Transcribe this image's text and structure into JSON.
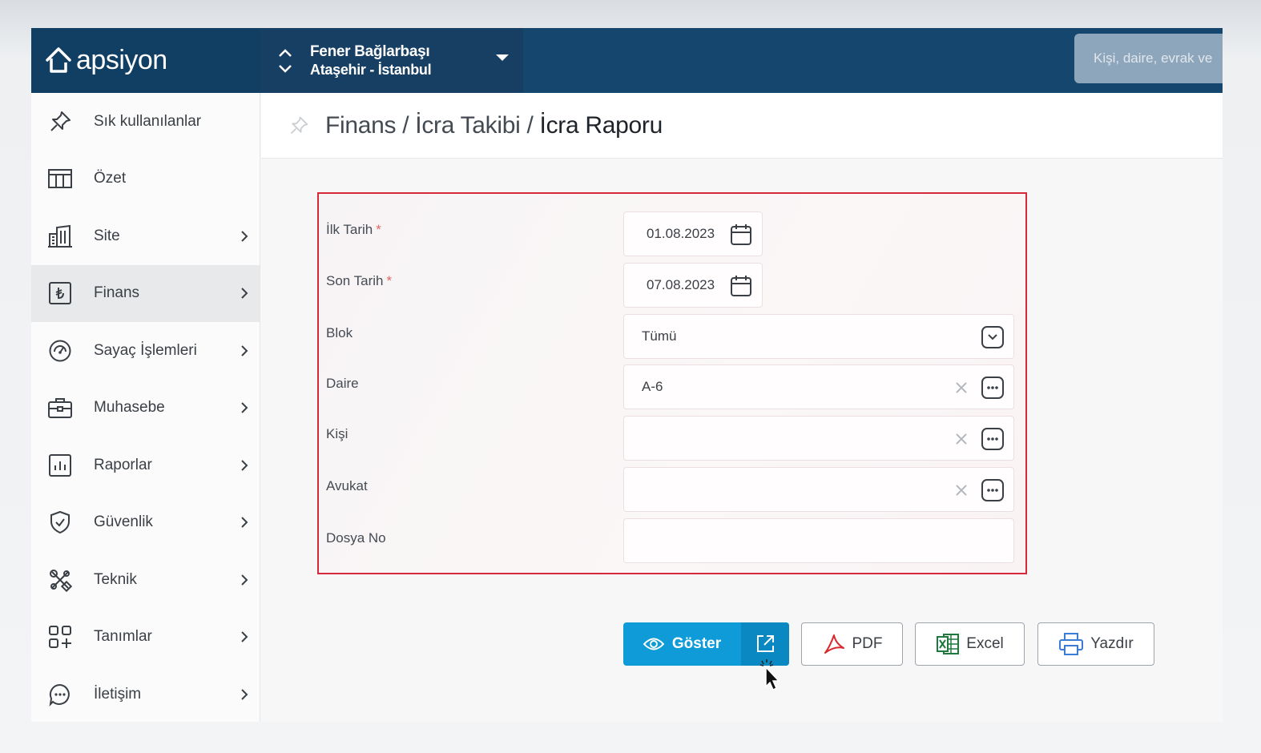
{
  "app": {
    "logo_text": "apsiyon"
  },
  "site": {
    "name": "Fener Bağlarbaşı",
    "location": "Ataşehir - İstanbul"
  },
  "search": {
    "placeholder": "Kişi, daire, evrak ve"
  },
  "sidebar": {
    "items": [
      {
        "label": "Sık kullanılanlar",
        "icon": "pin-icon",
        "has_children": false
      },
      {
        "label": "Özet",
        "icon": "table-icon",
        "has_children": false
      },
      {
        "label": "Site",
        "icon": "building-icon",
        "has_children": true
      },
      {
        "label": "Finans",
        "icon": "lira-icon",
        "has_children": true,
        "active": true
      },
      {
        "label": "Sayaç İşlemleri",
        "icon": "gauge-icon",
        "has_children": true
      },
      {
        "label": "Muhasebe",
        "icon": "briefcase-icon",
        "has_children": true
      },
      {
        "label": "Raporlar",
        "icon": "report-icon",
        "has_children": true
      },
      {
        "label": "Güvenlik",
        "icon": "shield-icon",
        "has_children": true
      },
      {
        "label": "Teknik",
        "icon": "tools-icon",
        "has_children": true
      },
      {
        "label": "Tanımlar",
        "icon": "grid-plus-icon",
        "has_children": true
      },
      {
        "label": "İletişim",
        "icon": "chat-icon",
        "has_children": true
      }
    ]
  },
  "breadcrumb": {
    "part1": "Finans",
    "part2": "İcra Takibi",
    "current": "İcra Raporu",
    "separator": "/"
  },
  "form": {
    "ilk_tarih": {
      "label": "İlk Tarih",
      "required": "*",
      "value": "01.08.2023"
    },
    "son_tarih": {
      "label": "Son Tarih",
      "required": "*",
      "value": "07.08.2023"
    },
    "blok": {
      "label": "Blok",
      "value": "Tümü"
    },
    "daire": {
      "label": "Daire",
      "value": "A-6"
    },
    "kisi": {
      "label": "Kişi",
      "value": ""
    },
    "avukat": {
      "label": "Avukat",
      "value": ""
    },
    "dosya_no": {
      "label": "Dosya No",
      "value": ""
    }
  },
  "actions": {
    "show_label": "Göster",
    "pdf_label": "PDF",
    "excel_label": "Excel",
    "print_label": "Yazdır"
  },
  "colors": {
    "topbar": "#15466e",
    "primary_button": "#0e9bd8",
    "error_border": "#d62a3a",
    "pdf_red": "#d8292f",
    "excel_green": "#1e7a3c",
    "print_blue": "#3a7bd5"
  }
}
